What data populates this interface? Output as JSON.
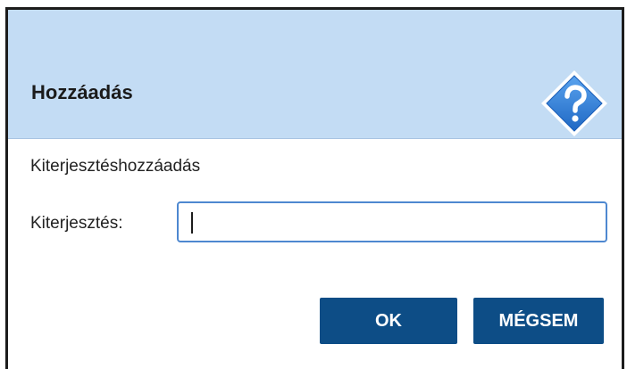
{
  "dialog": {
    "title": "Hozzáadás",
    "help_icon": "help-question-icon",
    "message": "Kiterjesztéshozzáadás",
    "field_label": "Kiterjesztés:",
    "field_value": "",
    "buttons": {
      "ok_label": "OK",
      "cancel_label": "MÉGSEM"
    },
    "colors": {
      "header_bg": "#c3dcf4",
      "button_bg": "#0d4d86",
      "input_border": "#4e88d0",
      "icon_blue": "#2f7ed8"
    }
  }
}
